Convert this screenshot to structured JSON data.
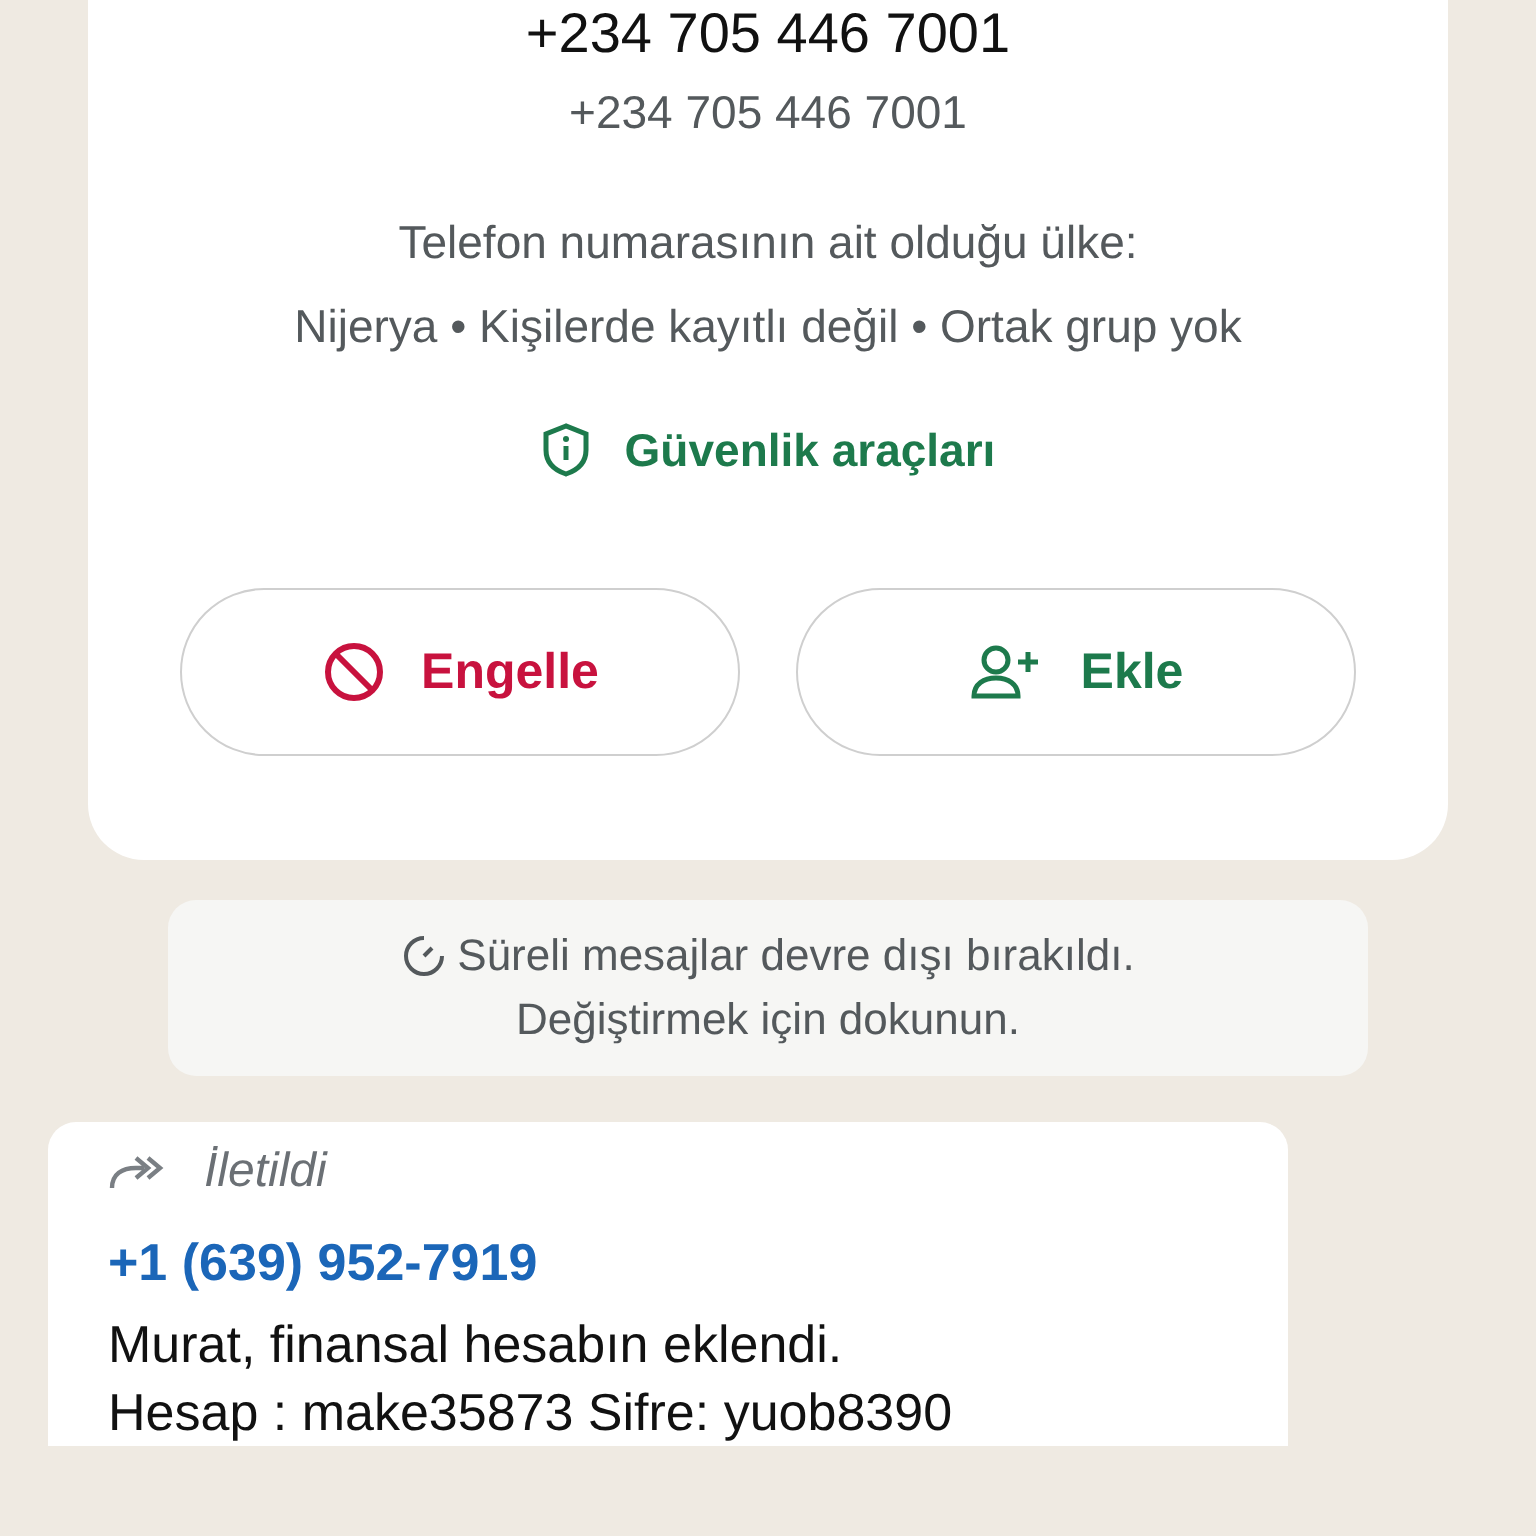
{
  "contact_card": {
    "title": "+234 705 446 7001",
    "phone": "+234 705 446 7001",
    "info": [
      "Telefon numarasının ait olduğu ülke:",
      "Nijerya • Kişilerde kayıtlı değil • Ortak grup yok"
    ],
    "security_link": "Güvenlik araçları",
    "buttons": [
      {
        "kind": "block",
        "label": "Engelle"
      },
      {
        "kind": "add",
        "label": "Ekle"
      }
    ]
  },
  "system_notice": {
    "lines": [
      "Süreli mesajlar devre dışı bırakıldı.",
      "Değiştirmek için dokunun."
    ]
  },
  "message": {
    "forwarded_label": "İletildi",
    "sender": "+1 (639) 952-7919",
    "lines": [
      "Murat, finansal hesabın eklendi.",
      "Hesap : make35873 Sifre: yuob8390"
    ]
  }
}
